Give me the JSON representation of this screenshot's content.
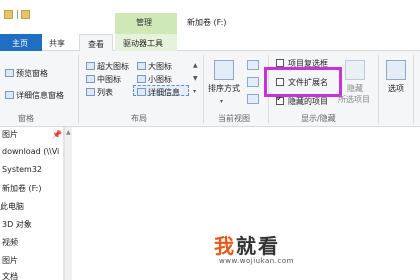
{
  "window": {
    "title": "新加卷 (F:)",
    "manage_label": "管理"
  },
  "tabs": {
    "file": "主页",
    "share": "共享",
    "view": "查看",
    "drive_tools": "驱动器工具"
  },
  "ribbon": {
    "panes": {
      "preview": "预览窗格",
      "details": "详细信息窗格",
      "group_label": "窗格"
    },
    "layout": {
      "items": [
        "超大图标",
        "大图标",
        "中图标",
        "小图标",
        "列表",
        "详细信息"
      ],
      "selected": "详细信息",
      "group_label": "布局"
    },
    "current_view": {
      "sort_label": "排序方式",
      "group_label": "当前视图"
    },
    "show_hide": {
      "item_checkboxes": {
        "label": "项目复选框",
        "checked": false
      },
      "file_extensions": {
        "label": "文件扩展名",
        "checked": false
      },
      "hidden_items": {
        "label": "隐藏的项目",
        "checked": true
      },
      "hide_selected": "隐藏",
      "hide_selected_sub": "所选项目",
      "group_label": "显示/隐藏"
    },
    "options": {
      "label": "选项"
    }
  },
  "nav": {
    "items": [
      "图片",
      "download (\\\\Vi",
      "System32",
      "新加卷 (F:)",
      "此电脑",
      "3D 对象",
      "视频",
      "图片",
      "文档"
    ]
  },
  "watermark": {
    "logo_1": "我",
    "logo_2": "就看",
    "url": "www.wojiukan.com"
  },
  "colors": {
    "accent": "#1e6fc2",
    "manage_band": "#cfe8b8",
    "highlight": "#c633d6"
  }
}
